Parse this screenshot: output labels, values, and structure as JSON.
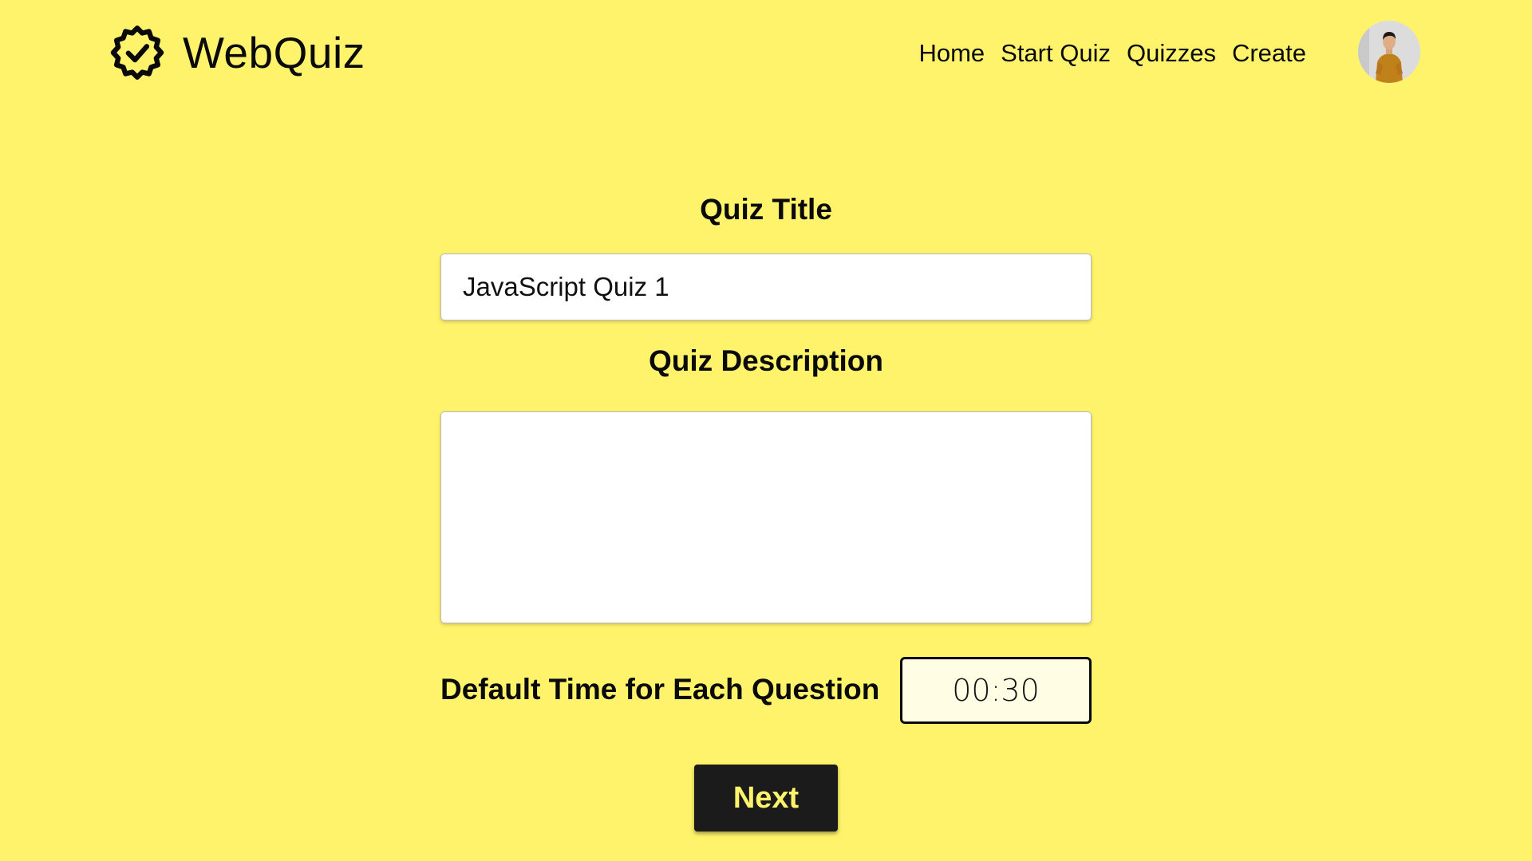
{
  "header": {
    "brand_name": "WebQuiz",
    "brand_icon": "badge-check-icon",
    "nav": {
      "home": "Home",
      "start_quiz": "Start Quiz",
      "quizzes": "Quizzes",
      "create": "Create"
    },
    "avatar_icon": "user-avatar"
  },
  "form": {
    "title_label": "Quiz Title",
    "title_value": "JavaScript Quiz 1",
    "description_label": "Quiz Description",
    "description_value": "",
    "time_label": "Default Time for Each Question",
    "time_value": "00:30",
    "next_label": "Next"
  },
  "colors": {
    "background": "#FFF36B",
    "button_bg": "#1b1b1b",
    "button_text": "#FFF36B",
    "time_field_bg": "#FFFDE3"
  }
}
